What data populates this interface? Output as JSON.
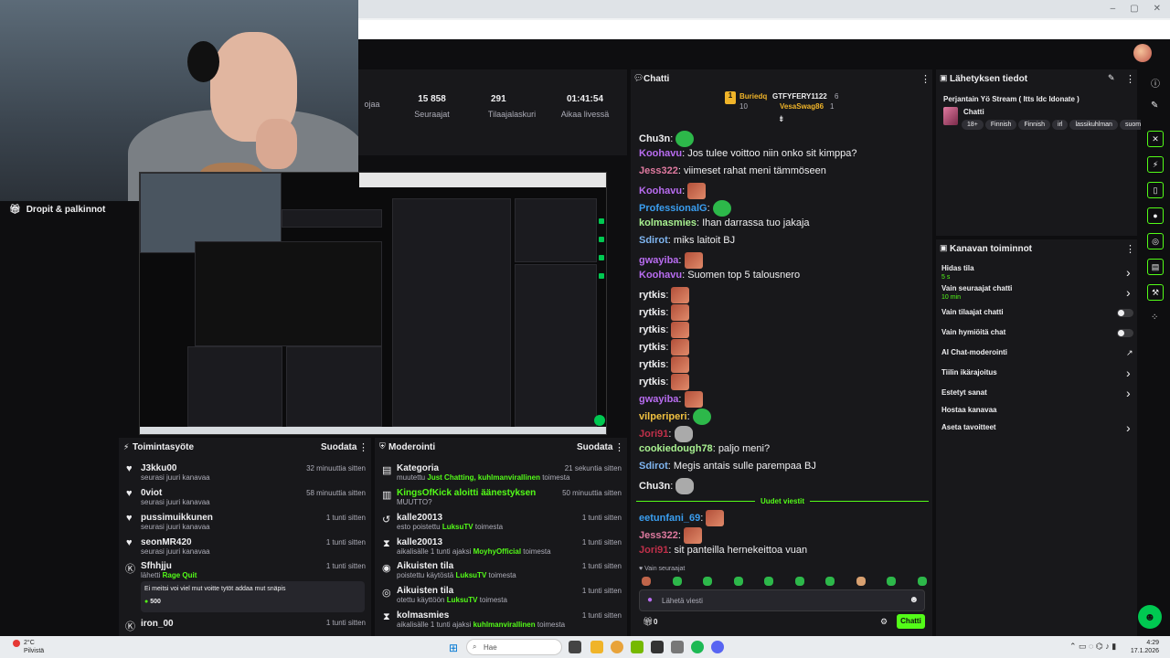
{
  "browser": {
    "window_controls": [
      "–",
      "▢",
      "✕"
    ]
  },
  "drops_title": "Dropit & palkinnot",
  "stats": [
    {
      "value": "",
      "label": "ojaa"
    },
    {
      "value": "15 858",
      "label": "Seuraajat"
    },
    {
      "value": "291",
      "label": "Tilaajalaskuri"
    },
    {
      "value": "01:41:54",
      "label": "Aikaa livessä"
    }
  ],
  "activity": {
    "title": "Toimintasyöte",
    "filter": "Suodata",
    "rows": [
      {
        "name": "J3kku00",
        "sub": "seurasi juuri kanavaa",
        "time": "32 minuuttia sitten"
      },
      {
        "name": "0viot",
        "sub": "seurasi juuri kanavaa",
        "time": "58 minuuttia sitten"
      },
      {
        "name": "pussimuikkunen",
        "sub": "seurasi juuri kanavaa",
        "time": "1 tunti sitten"
      },
      {
        "name": "seonMR420",
        "sub": "seurasi juuri kanavaa",
        "time": "1 tunti sitten"
      },
      {
        "name": "Sfhhjju",
        "sub_prefix": "lähetti",
        "sub_highlight": "Rage Quit",
        "time": "1 tunti sitten",
        "message": "Ei meitsi voi viel mut voitte tytöt addaa mut snäpis",
        "amount": "500"
      },
      {
        "name": "iron_00",
        "sub": "",
        "time": "1 tunti sitten"
      }
    ]
  },
  "moderation": {
    "title": "Moderointi",
    "filter": "Suodata",
    "rows": [
      {
        "name": "Kategoria",
        "pre": "muutettu",
        "hl": "Just Chatting, kuhlmanvirallinen",
        "post": "toimesta",
        "time": "21 sekuntia sitten"
      },
      {
        "name": "KingsOfKick aloitti äänestyksen",
        "pre": "MUUTTO?",
        "hl": "",
        "post": "",
        "time": "50 minuuttia sitten"
      },
      {
        "name": "kalle20013",
        "pre": "esto poistettu",
        "hl": "LuksuTV",
        "post": "toimesta",
        "time": "1 tunti sitten"
      },
      {
        "name": "kalle20013",
        "pre": "aikalisälle 1 tunti ajaksi",
        "hl": "MoyhyOfficial",
        "post": "toimesta",
        "time": "1 tunti sitten"
      },
      {
        "name": "Aikuisten tila",
        "pre": "poistettu käytöstä",
        "hl": "LuksuTV",
        "post": "toimesta",
        "time": "1 tunti sitten"
      },
      {
        "name": "Aikuisten tila",
        "pre": "otettu käyttöön",
        "hl": "LuksuTV",
        "post": "toimesta",
        "time": "1 tunti sitten"
      },
      {
        "name": "kolmasmies",
        "pre": "aikalisälle 1 tunti ajaksi",
        "hl": "kuhlmanvirallinen",
        "post": "toimesta",
        "time": "1 tunti sitten"
      }
    ]
  },
  "chat": {
    "title": "Chatti",
    "top_gifters": [
      {
        "rank": "1",
        "name": "Buriedq",
        "count": "10"
      },
      {
        "name": "GTFYFERY1122",
        "count": "6"
      },
      {
        "name": "VesaSwag86",
        "count": "1"
      }
    ],
    "messages": [
      {
        "user": "Chu3n",
        "color": "#efeff1",
        "text": "",
        "emote": "green"
      },
      {
        "user": "Koohavu",
        "color": "#b86cf0",
        "text": "Jos tulee voittoo niin onko sit kimppa?"
      },
      {
        "user": "Jess322",
        "color": "#e07aa0",
        "text": "viimeset rahat meni tämmöseen"
      },
      {
        "user": "Koohavu",
        "color": "#b86cf0",
        "text": "",
        "emote": "red"
      },
      {
        "user": "ProfessionalG",
        "color": "#3a9ef0",
        "text": "",
        "emote": "green"
      },
      {
        "user": "kolmasmies",
        "color": "#a8f090",
        "text": "Ihan darrassa tuo jakaja"
      },
      {
        "user": "Sdirot",
        "color": "#7fb5f0",
        "text": "miks laitoit BJ"
      },
      {
        "user": "gwayiba",
        "color": "#b86cf0",
        "text": "",
        "emote": "red"
      },
      {
        "user": "Koohavu",
        "color": "#b86cf0",
        "text": "Suomen top 5 talousnero"
      },
      {
        "user": "rytkis",
        "color": "#efeff1",
        "text": "",
        "emote": "red"
      },
      {
        "user": "rytkis",
        "color": "#efeff1",
        "text": "",
        "emote": "red"
      },
      {
        "user": "rytkis",
        "color": "#efeff1",
        "text": "",
        "emote": "red"
      },
      {
        "user": "rytkis",
        "color": "#efeff1",
        "text": "",
        "emote": "red"
      },
      {
        "user": "rytkis",
        "color": "#efeff1",
        "text": "",
        "emote": "red"
      },
      {
        "user": "rytkis",
        "color": "#efeff1",
        "text": "",
        "emote": "red"
      },
      {
        "user": "gwayiba",
        "color": "#b86cf0",
        "text": "",
        "emote": "red"
      },
      {
        "user": "vilperiperi",
        "color": "#f0c040",
        "text": "",
        "emote": "green"
      },
      {
        "user": "Jori91",
        "color": "#c0304a",
        "text": "",
        "emote": "grey"
      },
      {
        "user": "cookiedough78",
        "color": "#a8f090",
        "text": "paljo meni?"
      },
      {
        "user": "Sdirot",
        "color": "#7fb5f0",
        "text": "Megis antais sulle parempaa BJ"
      },
      {
        "user": "Chu3n",
        "color": "#efeff1",
        "text": "",
        "emote": "grey"
      }
    ],
    "new_messages_label": "Uudet viestit",
    "new_messages": [
      {
        "user": "eetunfani_69",
        "color": "#3a9ef0",
        "text": "",
        "emote": "red"
      },
      {
        "user": "Jess322",
        "color": "#e07aa0",
        "text": "",
        "emote": "red"
      },
      {
        "user": "Jori91",
        "color": "#c0304a",
        "text": "sit panteilla hernekeittoa vuan"
      }
    ],
    "followers_only": "Vain seuraajat",
    "input_placeholder": "Lähetä viesti",
    "viewer_count": "0",
    "send_label": "Chatti"
  },
  "stream_info": {
    "title": "Lähetyksen tiedot",
    "stream_title": "Perjantain Yö Stream ( Itts Idc Idonate )",
    "category": "Chatti",
    "tags": [
      "18+",
      "Finnish",
      "Finnish",
      "irl",
      "lassikuhlman",
      "suomi"
    ]
  },
  "channel_actions": {
    "title": "Kanavan toiminnot",
    "rows": [
      {
        "label": "Hidas tila",
        "sub": "5 s",
        "control": "chevron"
      },
      {
        "label": "Vain seuraajat chatti",
        "sub": "10 min",
        "control": "chevron"
      },
      {
        "label": "Vain tilaajat chatti",
        "sub": "",
        "control": "toggle"
      },
      {
        "label": "Vain hymiöitä chat",
        "sub": "",
        "control": "toggle"
      },
      {
        "label": "AI Chat-moderointi",
        "sub": "",
        "control": "external"
      },
      {
        "label": "Tiilin ikärajoitus",
        "sub": "",
        "control": "chevron"
      },
      {
        "label": "Estetyt sanat",
        "sub": "",
        "control": "chevron"
      },
      {
        "label": "Hostaa kanavaa",
        "sub": "",
        "control": "none"
      },
      {
        "label": "Aseta tavoitteet",
        "sub": "",
        "control": "chevron"
      }
    ]
  },
  "taskbar": {
    "weather_temp": "2°C",
    "weather_desc": "Pilvistä",
    "search_placeholder": "Hae",
    "time": "4:29",
    "date": "17.1.2026"
  },
  "colors": {
    "accent": "#53fc18",
    "panel": "#18181b",
    "bg": "#0e0e10"
  }
}
